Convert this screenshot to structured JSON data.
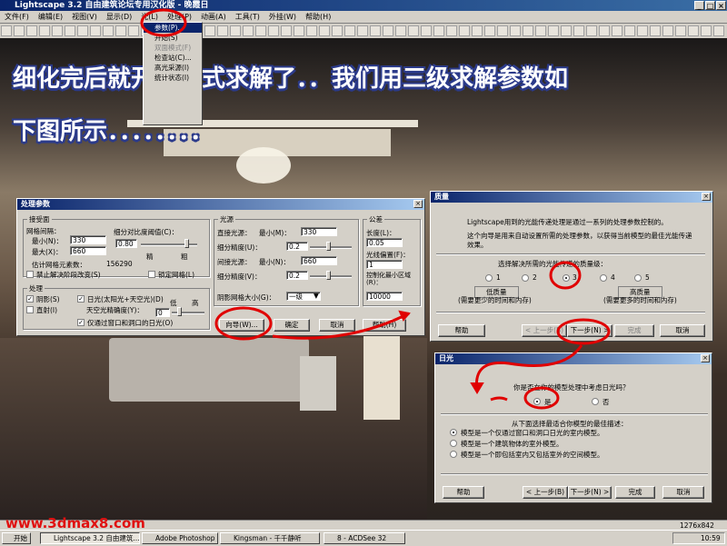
{
  "window": {
    "title": "Lightscape 3.2 自由建筑论坛专用汉化版 - 晚霞日"
  },
  "menubar": [
    "文件(F)",
    "编辑(E)",
    "视图(V)",
    "显示(D)",
    "光(L)",
    "处理(P)",
    "动画(A)",
    "工具(T)",
    "外挂(W)",
    "帮助(H)"
  ],
  "dropdown": {
    "items": [
      "参数(P)...",
      "开始(S)",
      "双面模式(F)",
      "检查站(C)...",
      "高光采源(I)",
      "统计状态(I)"
    ]
  },
  "banner": {
    "line1": "细化完后就开始正式求解了．．我们用三级求解参数如",
    "line2": "下图所示．．．．．．．．"
  },
  "params_dialog": {
    "title": "处理参数",
    "receiving": {
      "label": "接受面",
      "mesh_spacing": "网格间隔：",
      "min_label": "最小(N)：",
      "min_value": "330",
      "max_label": "最大(X)：",
      "max_value": "660",
      "subdiv_label": "细分对比度阈值(C)：",
      "subdiv_value": "0.80",
      "fine": "精",
      "coarse": "粗",
      "estimate_label": "估计网格元素数：",
      "estimate_value": "156290",
      "disable_resolution": "禁止解决阶段改变(S)",
      "lock_mesh": "锁定网格(L)"
    },
    "processing": {
      "label": "处理",
      "shadow": "阴影(S)",
      "daylight": "日光(太阳光+天空光)(D)",
      "direct_only": "直射(I)",
      "sky_precision": "天空光精确度(Y)：",
      "low": "低",
      "high": "高",
      "sky_value": "0",
      "window_only": "仅通过窗口和洞口的日光(O)"
    },
    "light": {
      "label": "光源",
      "direct_label": "直接光源：",
      "min_label": "最小(M)：",
      "direct_min": "330",
      "subdiv_precision": "细分精度(U)：",
      "subdiv_value": "0.2",
      "indirect_label": "间接光源：",
      "indirect_min_label": "最小(N)：",
      "indirect_min": "660",
      "subdiv_precision2": "细分精度(V)：",
      "subdiv_value2": "0.2",
      "shadow_mesh_label": "阴影网格大小(G)：",
      "shadow_mesh_value": "一级"
    },
    "tolerance": {
      "label": "公差",
      "length_label": "长度(L)：",
      "length_value": "0.05",
      "offset_label": "光线偏置(F)：",
      "offset_value": "1",
      "min_area_label": "控制化最小区域(R)：",
      "min_area_value": "10000"
    },
    "buttons": {
      "wizard": "向导(W)...",
      "ok": "确定",
      "cancel": "取消",
      "help": "帮助(H)"
    }
  },
  "quality_dialog": {
    "title": "质量",
    "text1": "Lightscape用到的光能传递处理是通过一系列的处理参数控制的。",
    "text2": "这个向导是用来自动设置所需的处理参数，以获得当前模型的最佳光能传递效果。",
    "choose": "选择解决所需的光能传递的质量级：",
    "options": [
      "1",
      "2",
      "3",
      "4",
      "5"
    ],
    "selected": "3",
    "low_quality": "低质量",
    "low_desc": "(需要更少的时间和内存)",
    "high_quality": "高质量",
    "high_desc": "(需要更多的时间和内存)",
    "buttons": {
      "help": "帮助",
      "back": "< 上一步(B)",
      "next": "下一步(N) >",
      "finish": "完成",
      "cancel": "取消"
    }
  },
  "daylight_dialog": {
    "title": "日光",
    "question": "你是否在你的模型处理中考虑日光吗？",
    "yes": "是",
    "no": "否",
    "selected": "是",
    "prompt": "从下面选择最适合你模型的最佳描述：",
    "options": [
      "模型是一个仅通过窗口和洞口日光的室内模型。",
      "模型是一个建筑物体的室外模型。",
      "模型是一个即包括室内又包括室外的空间模型。"
    ],
    "selected_option": 0,
    "buttons": {
      "help": "帮助",
      "back": "< 上一步(B)",
      "next": "下一步(N) >",
      "finish": "完成",
      "cancel": "取消"
    }
  },
  "taskbar": {
    "start": "开始",
    "items": [
      "Lightscape 3.2 自由建筑...",
      "Adobe Photoshop",
      "Kingsman - 千千静听",
      "8 - ACDSee 32"
    ],
    "resolution": "1276x842",
    "clock": "10:59"
  },
  "watermark": "www.3dmax8.com"
}
